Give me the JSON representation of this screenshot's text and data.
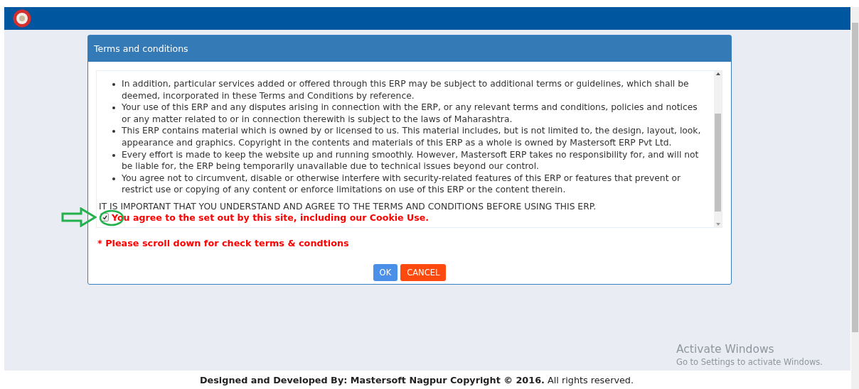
{
  "dialog": {
    "title": "Terms and conditions",
    "terms": [
      "In addition, particular services added or offered through this ERP may be subject to additional terms or guidelines, which shall be deemed, incorporated in these Terms and Conditions by reference.",
      "Your use of this ERP and any disputes arising in connection with the ERP, or any relevant terms and conditions, policies and notices or any matter related to or in connection therewith is subject to the laws of Maharashtra.",
      "This ERP contains material which is owned by or licensed to us. This material includes, but is not limited to, the design, layout, look, appearance and graphics. Copyright in the contents and materials of this ERP as a whole is owned by Mastersoft ERP Pvt Ltd.",
      "Every effort is made to keep the website up and running smoothly. However, Mastersoft ERP takes no responsibility for, and will not be liable for, the ERP being temporarily unavailable due to technical issues beyond our control.",
      "You agree not to circumvent, disable or otherwise interfere with security-related features of this ERP or features that prevent or restrict use or copying of any content or enforce limitations on use of this ERP or the content therein."
    ],
    "notice": "IT IS IMPORTANT THAT YOU UNDERSTAND AND AGREE TO THE TERMS AND CONDITIONS BEFORE USING THIS ERP.",
    "agree": {
      "label": "You agree to the set out by this site, including our Cookie Use.",
      "checked": true
    },
    "warning": "* Please scroll down for check terms & condtions",
    "buttons": [
      {
        "label": "OK",
        "kind": "primary"
      },
      {
        "label": "CANCEL",
        "kind": "danger"
      }
    ]
  },
  "activation": {
    "title": "Activate Windows",
    "hint": "Go to Settings to activate Windows."
  },
  "footer": "**Designed and Developed By: Mastersoft Nagpur Copyright © 2016.** All rights reserved."
}
